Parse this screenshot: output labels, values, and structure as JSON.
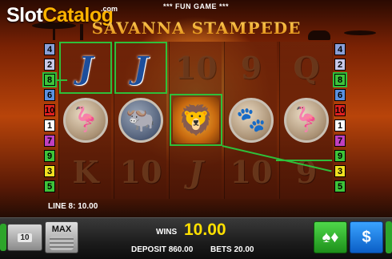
{
  "brand": {
    "part1": "Slot",
    "part2": "Catalog",
    "suffix": ".com"
  },
  "header": {
    "mode": "*** FUN GAME ***",
    "title": "SAVANNA STAMPEDE"
  },
  "line_numbers_left": [
    "4",
    "2",
    "8",
    "6",
    "10",
    "1",
    "7",
    "9",
    "3",
    "5"
  ],
  "line_numbers_right": [
    "4",
    "2",
    "8",
    "6",
    "10",
    "1",
    "7",
    "9",
    "3",
    "5"
  ],
  "line_number_colors": [
    "#8aa0d8",
    "#c8c8e8",
    "#3ec43a",
    "#5a90e0",
    "#e02020",
    "#ffffff",
    "#c040c0",
    "#3ec43a",
    "#f0e020",
    "#3ec43a"
  ],
  "reels": [
    [
      {
        "symbol": "J",
        "win": true
      },
      {
        "symbol": "flamingo"
      },
      {
        "symbol": "K"
      }
    ],
    [
      {
        "symbol": "J",
        "win": true
      },
      {
        "symbol": "buffalo"
      },
      {
        "symbol": "10"
      }
    ],
    [
      {
        "symbol": "10"
      },
      {
        "symbol": "lion",
        "win": true
      },
      {
        "symbol": "J"
      }
    ],
    [
      {
        "symbol": "9"
      },
      {
        "symbol": "meerkat"
      },
      {
        "symbol": "10"
      }
    ],
    [
      {
        "symbol": "Q"
      },
      {
        "symbol": "flamingo"
      },
      {
        "symbol": "9"
      }
    ]
  ],
  "line_win": "LINE 8: 10.00",
  "wins": {
    "label": "WINS",
    "value": "10.00"
  },
  "deposit": {
    "label": "DEPOSIT",
    "value": "860.00"
  },
  "bets": {
    "label": "BETS",
    "value": "20.00"
  },
  "controls": {
    "lines_label": "10",
    "max_label": "MAX"
  },
  "icons": {
    "gamble": "cards-icon",
    "cash": "money-bag-icon",
    "lines": "lines-icon",
    "max": "coins-icon"
  }
}
